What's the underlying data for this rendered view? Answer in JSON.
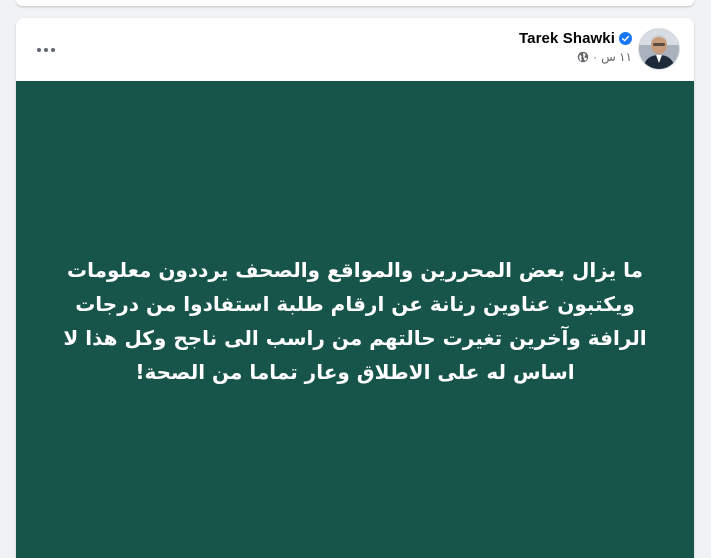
{
  "post": {
    "author": "Tarek Shawki",
    "verified": true,
    "timestamp": "١١ س",
    "audience_icon": "globe-icon",
    "more_icon": "more-options-icon",
    "background_color": "#17554a",
    "text": "ما يزال بعض المحررين والمواقع والصحف يرددون معلومات ويكتبون عناوين رنانة عن ارقام طلبة استفادوا من درجات الرافة وآخرين تغيرت حالتهم من راسب الى ناجح وكل هذا لا اساس له على الاطلاق وعار تماما من الصحة!"
  },
  "colors": {
    "verified_badge": "#1877f2",
    "meta_text": "#65676b",
    "name_text": "#050505"
  }
}
